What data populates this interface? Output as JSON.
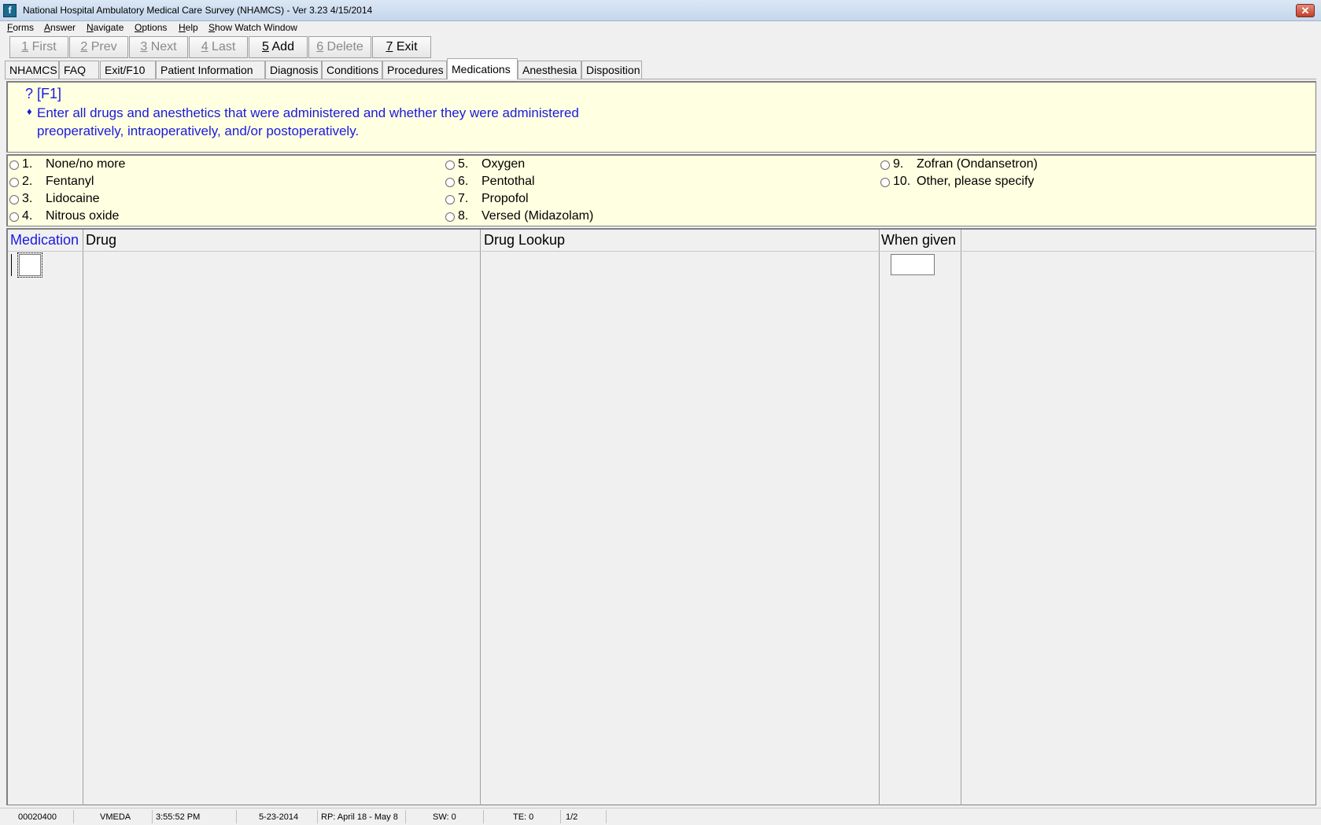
{
  "window": {
    "title": "National Hospital Ambulatory Medical Care Survey (NHAMCS) - Ver 3.23 4/15/2014",
    "app_icon_glyph": "f",
    "close_glyph": "✕"
  },
  "menubar": [
    {
      "key": "F",
      "rest": "orms"
    },
    {
      "key": "A",
      "rest": "nswer"
    },
    {
      "key": "N",
      "rest": "avigate"
    },
    {
      "key": "O",
      "rest": "ptions"
    },
    {
      "key": "H",
      "rest": "elp"
    },
    {
      "key": "S",
      "rest": "how Watch Window"
    }
  ],
  "toolbar": [
    {
      "key": "1",
      "label": " First",
      "enabled": false
    },
    {
      "key": "2",
      "label": " Prev",
      "enabled": false
    },
    {
      "key": "3",
      "label": " Next",
      "enabled": false
    },
    {
      "key": "4",
      "label": " Last",
      "enabled": false
    },
    {
      "key": "5",
      "label": " Add",
      "enabled": true
    },
    {
      "key": "6",
      "label": " Delete",
      "enabled": false
    },
    {
      "key": "7",
      "label": " Exit",
      "enabled": true
    }
  ],
  "tabs": [
    "NHAMCS",
    "FAQ",
    "Exit/F10",
    "Patient Information",
    "Diagnosis",
    "Conditions",
    "Procedures",
    "Medications",
    "Anesthesia",
    "Disposition"
  ],
  "selected_tab": "Medications",
  "help": {
    "key": "? [F1]",
    "bullet": "♦",
    "line1": "Enter all drugs and anesthetics that were administered and whether they were administered",
    "line2": "preoperatively, intraoperatively, and/or postoperatively.",
    "text_color": "#1a1ae0"
  },
  "options": [
    {
      "num": "1.",
      "label": "None/no more"
    },
    {
      "num": "2.",
      "label": "Fentanyl"
    },
    {
      "num": "3.",
      "label": "Lidocaine"
    },
    {
      "num": "4.",
      "label": "Nitrous oxide"
    },
    {
      "num": "5.",
      "label": "Oxygen"
    },
    {
      "num": "6.",
      "label": "Pentothal"
    },
    {
      "num": "7.",
      "label": "Propofol"
    },
    {
      "num": "8.",
      "label": "Versed (Midazolam)"
    },
    {
      "num": "9.",
      "label": "Zofran (Ondansetron)"
    },
    {
      "num": "10.",
      "label": "Other, please specify"
    }
  ],
  "grid": {
    "headers": [
      "Medication",
      "Drug",
      "Drug Lookup",
      "When given"
    ],
    "medication_value": "",
    "when_given_value": "",
    "active_header_color": "#1a1ae0"
  },
  "statusbar": [
    "00020400",
    "VMEDA",
    "3:55:52 PM",
    "5-23-2014",
    "RP: April 18  - May 8",
    "SW: 0",
    "TE: 0",
    "1/2"
  ],
  "colors": {
    "panel_bg": "#ffffe1",
    "window_bg": "#f0f0f0"
  }
}
